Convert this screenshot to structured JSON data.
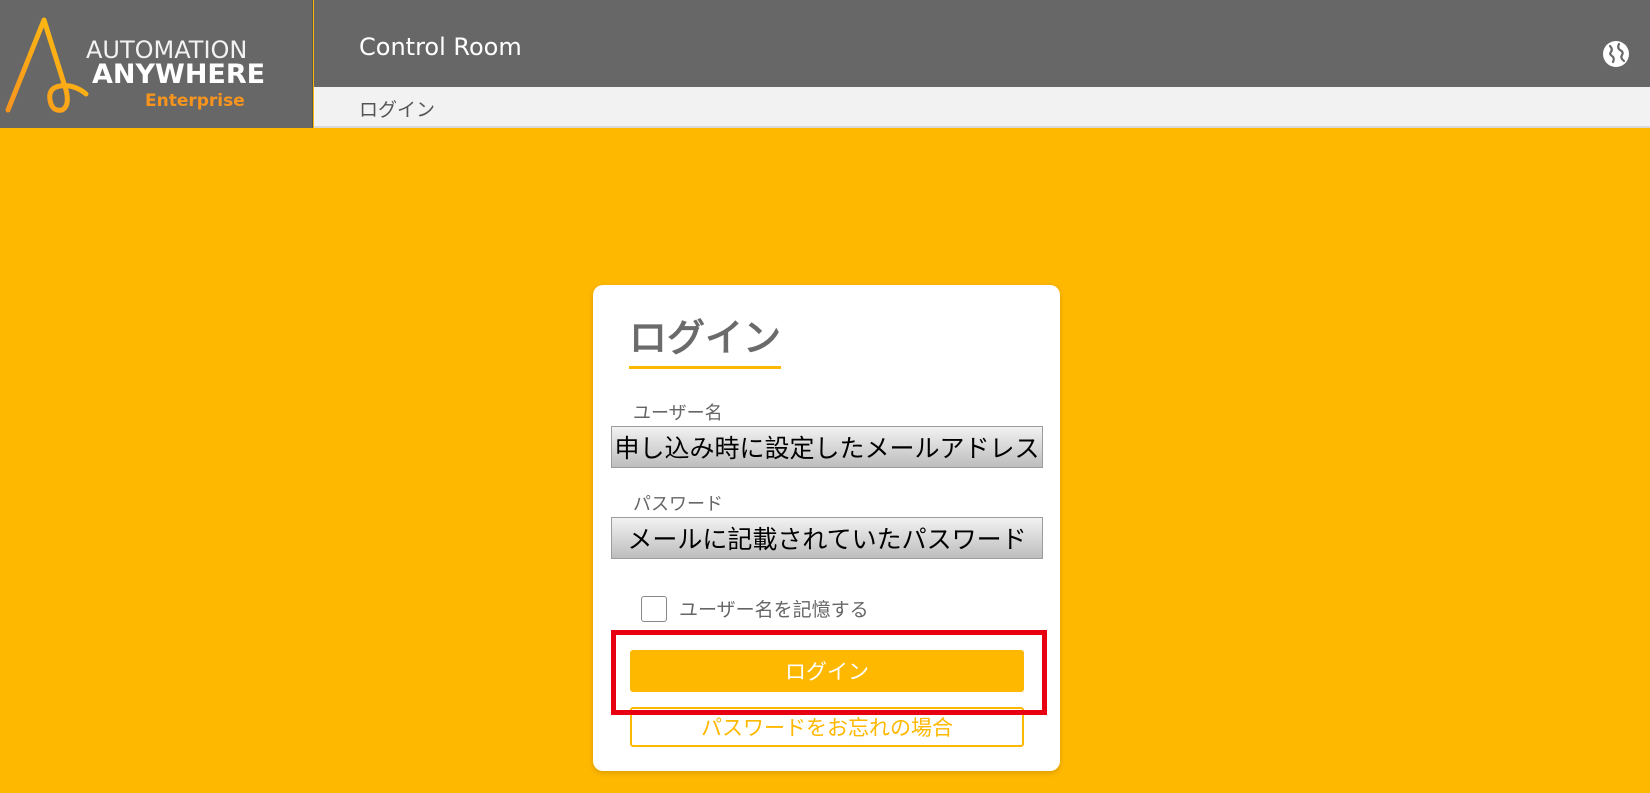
{
  "brand": {
    "line1": "AUTOMATION",
    "line2": "ANYWHERE",
    "line3": "Enterprise",
    "logo_icon": "automation-anywhere-a-logo"
  },
  "header": {
    "title": "Control Room",
    "globe_icon": "globe-icon"
  },
  "breadcrumb": {
    "current": "ログイン"
  },
  "login_card": {
    "title": "ログイン",
    "username": {
      "label": "ユーザー名",
      "value": "",
      "placeholder": "",
      "note": "申し込み時に設定したメールアドレス"
    },
    "password": {
      "label": "パスワード",
      "value": "",
      "placeholder": "",
      "note": "メールに記載されていたパスワード"
    },
    "remember": {
      "label": "ユーザー名を記憶する",
      "checked": false
    },
    "login_button": "ログイン",
    "forgot_button": "パスワードをお忘れの場合"
  },
  "colors": {
    "background": "#FFB800",
    "header": "#676767",
    "accent": "#FFB800",
    "logo_orange": "#F7941E",
    "highlight": "#E60012"
  }
}
